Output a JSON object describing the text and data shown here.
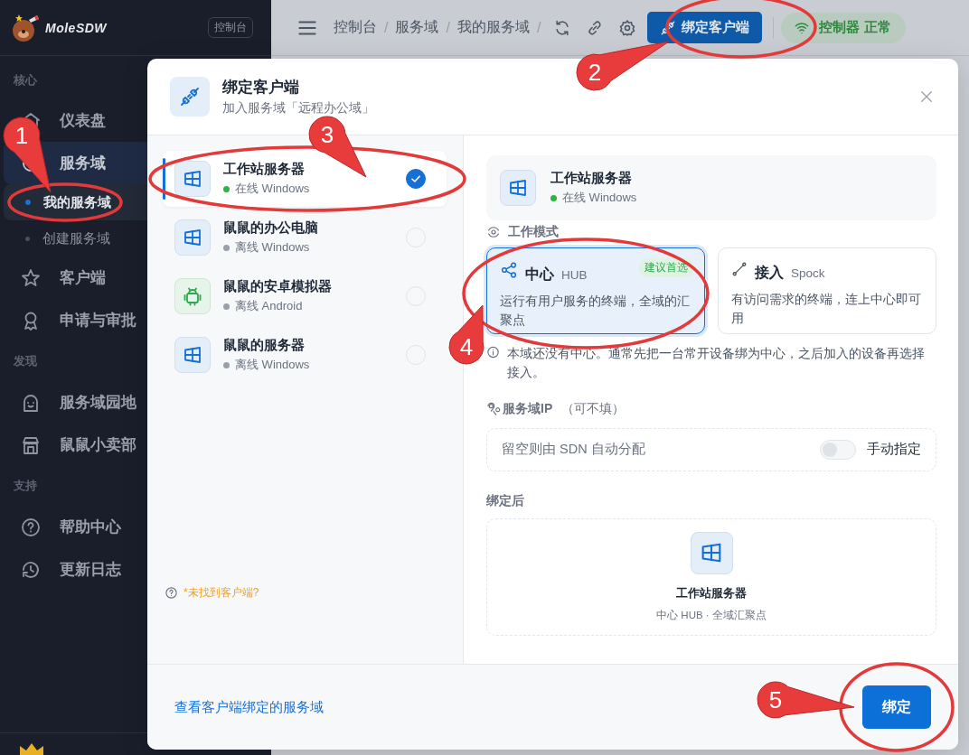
{
  "sidebar": {
    "logo": "MoleSDW",
    "badge": "控制台",
    "sections": [
      {
        "title": "核心",
        "items": [
          {
            "label": "仪表盘",
            "selected": false
          },
          {
            "label": "服务域",
            "selected": true,
            "children": [
              {
                "label": "我的服务域",
                "selected": true
              },
              {
                "label": "创建服务域",
                "selected": false
              }
            ]
          },
          {
            "label": "客户端",
            "selected": false
          },
          {
            "label": "申请与审批",
            "selected": false
          }
        ]
      },
      {
        "title": "发现",
        "items": [
          {
            "label": "服务域园地",
            "selected": false
          },
          {
            "label": "鼠鼠小卖部",
            "selected": false
          }
        ]
      },
      {
        "title": "支持",
        "items": [
          {
            "label": "帮助中心",
            "selected": false
          },
          {
            "label": "更新日志",
            "selected": false
          }
        ]
      }
    ]
  },
  "topbar": {
    "breadcrumb": [
      {
        "label": "控制台"
      },
      {
        "label": "服务域"
      },
      {
        "label": "我的服务域"
      }
    ],
    "separator": "/",
    "bind_button": "绑定客户端",
    "status": "控制器 正常"
  },
  "dialog": {
    "title": "绑定客户端",
    "subtitle": "加入服务域「远程办公域」",
    "devices": [
      {
        "kind": "windows",
        "name": "工作站服务器",
        "status": "在线 Windows",
        "online": true,
        "selected": true
      },
      {
        "kind": "windows",
        "name": "鼠鼠的办公电脑",
        "status": "离线 Windows",
        "online": false,
        "selected": false
      },
      {
        "kind": "android",
        "name": "鼠鼠的安卓模拟器",
        "status": "离线 Android",
        "online": false,
        "selected": false
      },
      {
        "kind": "windows",
        "name": "鼠鼠的服务器",
        "status": "离线 Windows",
        "online": false,
        "selected": false
      }
    ],
    "help_link": "*未找到客户端?",
    "selected_device": {
      "kind": "windows",
      "name": "工作站服务器",
      "status": "在线 Windows",
      "online": true
    },
    "mode_label": "工作模式",
    "modes": [
      {
        "kind": "hub",
        "title": "中心",
        "code": "HUB",
        "tag": "建议首选",
        "description": "运行有用户服务的终端，全域的汇聚点",
        "selected": true
      },
      {
        "kind": "spoke",
        "title": "接入",
        "code": "Spock",
        "description": "有访问需求的终端，连上中心即可用",
        "selected": false
      }
    ],
    "note": "本域还没有中心。通常先把一台常开设备绑为中心，之后加入的设备再选择接入。",
    "ip_label": "服务域IP",
    "ip_hint": "（可不填）",
    "ip_placeholder": "留空则由 SDN 自动分配",
    "manual_toggle": {
      "label": "手动指定",
      "on": false
    },
    "preview_label": "绑定后",
    "preview": {
      "kind": "windows",
      "name": "工作站服务器",
      "caption": "中心 HUB · 全域汇聚点"
    },
    "footer_link": "查看客户端绑定的服务域",
    "confirm_button": "绑定"
  },
  "annotations": [
    {
      "label": "1"
    },
    {
      "label": "2"
    },
    {
      "label": "3"
    },
    {
      "label": "4"
    },
    {
      "label": "5"
    }
  ]
}
